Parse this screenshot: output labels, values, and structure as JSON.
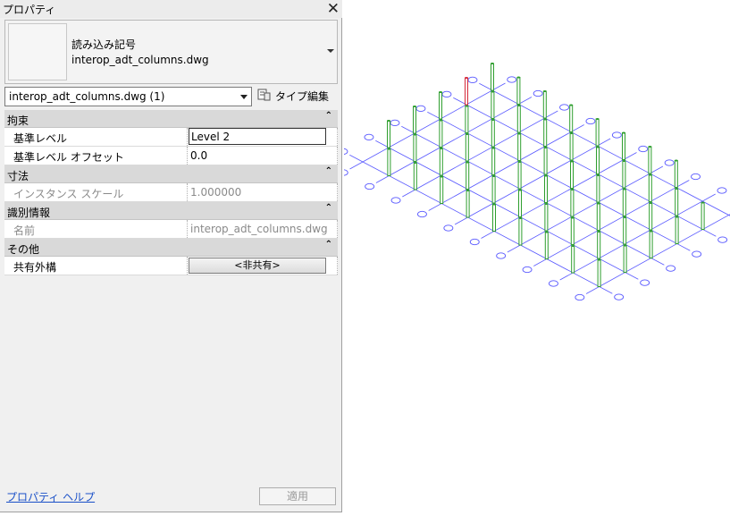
{
  "panel": {
    "title": "プロパティ",
    "close_glyph": "✕",
    "type_selector": {
      "line1": "読み込み記号",
      "line2": "interop_adt_columns.dwg"
    },
    "instance_selector": "interop_adt_columns.dwg (1)",
    "edit_type_label": "タイプ編集",
    "sections": [
      {
        "label": "拘束",
        "rows": [
          {
            "name": "基準レベル",
            "value": "Level 2"
          },
          {
            "name": "基準レベル オフセット",
            "value": "0.0"
          }
        ]
      },
      {
        "label": "寸法",
        "rows": [
          {
            "name": "インスタンス スケール",
            "value": "1.000000"
          }
        ]
      },
      {
        "label": "識別情報",
        "rows": [
          {
            "name": "名前",
            "value": "interop_adt_columns.dwg"
          }
        ]
      },
      {
        "label": "その他",
        "rows": [
          {
            "name": "共有外構",
            "value": "<非共有>"
          }
        ]
      }
    ],
    "collapse_glyph": "⌃",
    "help_link": "プロパティ ヘルプ",
    "apply_button": "適用"
  },
  "colors": {
    "grid_line": "#5a5aff",
    "column_normal": "#2e9e2e",
    "column_selected": "#d42a3a",
    "link": "#1a50c8"
  }
}
